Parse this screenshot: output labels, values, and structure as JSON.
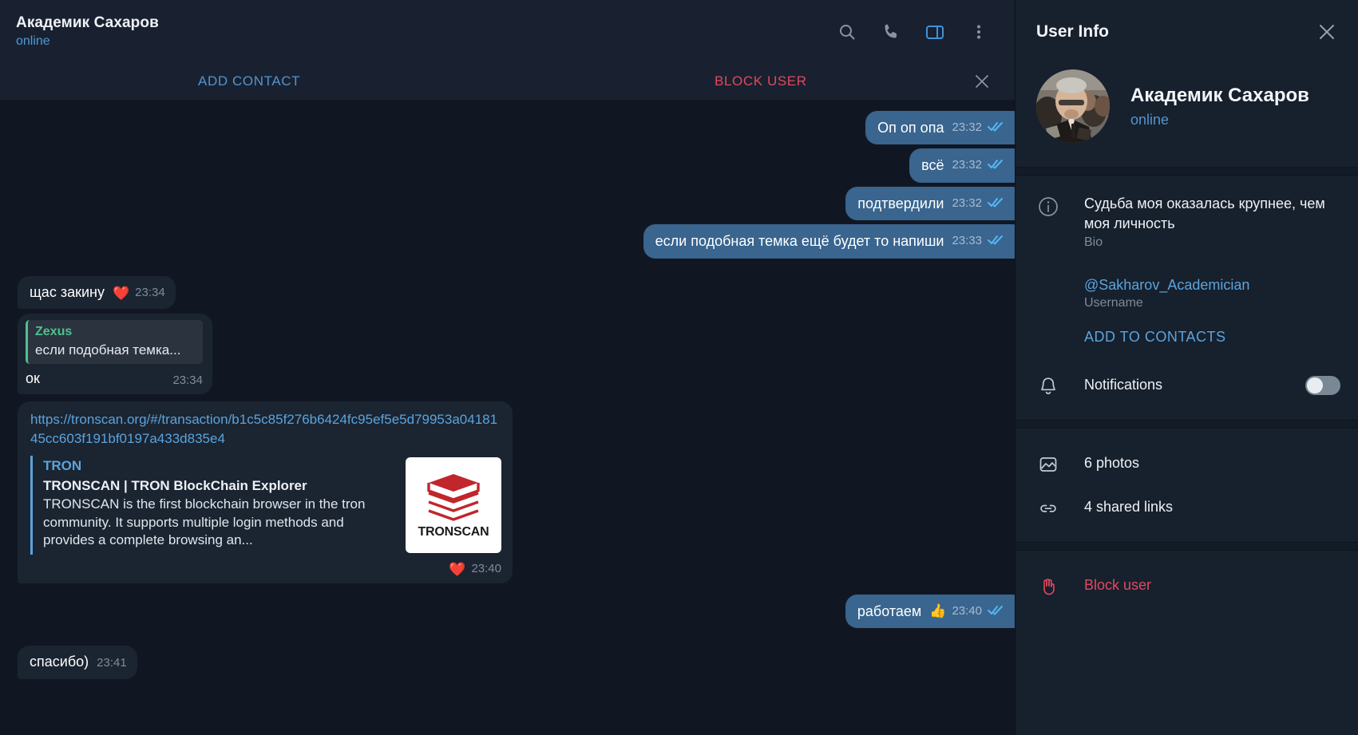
{
  "chat": {
    "header": {
      "name": "Академик Сахаров",
      "status": "online",
      "icons": [
        "search-icon",
        "phone-icon",
        "sidebar-toggle-icon",
        "more-options-icon"
      ]
    },
    "action_bar": {
      "add_contact": "ADD CONTACT",
      "block_user": "BLOCK USER",
      "close": "×"
    },
    "messages": [
      {
        "id": "m1",
        "dir": "out",
        "text": "Оп оп опа",
        "time": "23:32",
        "status": "read"
      },
      {
        "id": "m2",
        "dir": "out",
        "text": "всё",
        "time": "23:32",
        "status": "read"
      },
      {
        "id": "m3",
        "dir": "out",
        "text": "подтвердили",
        "time": "23:32",
        "status": "read"
      },
      {
        "id": "m4",
        "dir": "out",
        "text": "если подобная темка ещё будет то напиши",
        "time": "23:33",
        "status": "read"
      },
      {
        "id": "m5",
        "dir": "in",
        "text": "щас закину",
        "time": "23:34",
        "reaction": "❤️"
      },
      {
        "id": "m6",
        "dir": "in",
        "text": "ок",
        "time": "23:34",
        "quote": {
          "name": "Zexus",
          "text": "если подобная темка..."
        }
      },
      {
        "id": "m7",
        "dir": "in",
        "time": "23:40",
        "reaction": "❤️",
        "url": "https://tronscan.org/#/transaction/b1c5c85f276b6424fc95ef5e5d79953a0418145cc603f191bf0197a433d835e4",
        "preview": {
          "site": "TRON",
          "title": "TRONSCAN | TRON BlockChain Explorer",
          "description": "TRONSCAN is the first blockchain browser in the tron community. It supports multiple login methods and provides a complete browsing an...",
          "thumb_label": "TRONSCAN"
        }
      },
      {
        "id": "m8",
        "dir": "out",
        "text": "работаем",
        "time": "23:40",
        "status": "read",
        "reaction": "👍"
      },
      {
        "id": "m9",
        "dir": "in",
        "text": "спасибо)",
        "time": "23:41"
      }
    ]
  },
  "sidebar": {
    "title": "User Info",
    "close_label": "×",
    "profile": {
      "name": "Академик Сахаров",
      "status": "online"
    },
    "bio": {
      "text": "Судьба моя оказалась крупнее, чем моя личность",
      "label": "Bio"
    },
    "username": {
      "text": "@Sakharov_Academician",
      "label": "Username"
    },
    "add_to_contacts": "ADD TO CONTACTS",
    "notifications": {
      "label": "Notifications",
      "enabled": false
    },
    "media": [
      {
        "icon": "photo-icon",
        "label": "6 photos"
      },
      {
        "icon": "link-icon",
        "label": "4 shared links"
      }
    ],
    "block_user": {
      "label": "Block user",
      "icon": "hand-stop-icon"
    }
  },
  "colors": {
    "chat_bg": "#111722",
    "header_bg": "#192130",
    "sidebar_bg": "#17202d",
    "out_bubble": "#39658f",
    "in_bubble": "#1b2431",
    "accent_blue": "#5aa4dd",
    "danger_red": "#e2485d",
    "quote_green": "#4fc08d"
  }
}
